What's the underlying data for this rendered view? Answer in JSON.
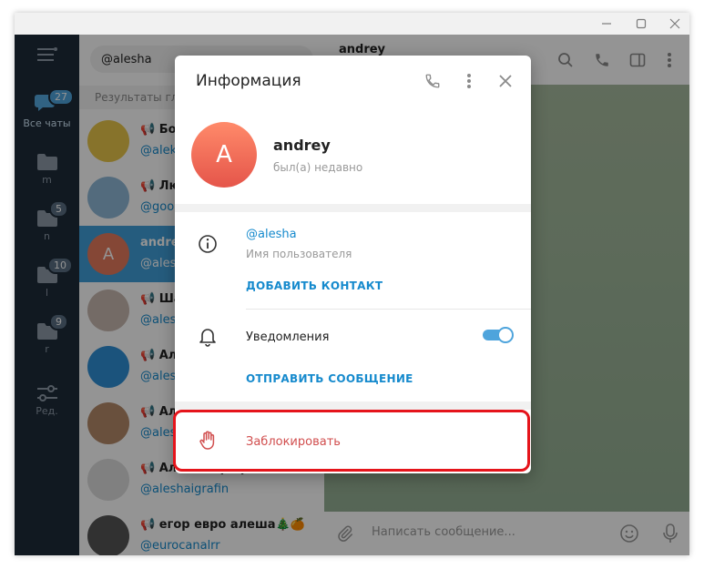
{
  "window": {
    "minimize": "—",
    "maximize": "☐",
    "close": "✕"
  },
  "rail": {
    "items": [
      {
        "id": "all",
        "label": "Все чаты",
        "badge": "27",
        "icon": "chat-bubbles-icon"
      },
      {
        "id": "m",
        "label": "m",
        "badge": "",
        "icon": "folder-icon"
      },
      {
        "id": "n",
        "label": "n",
        "badge": "5",
        "icon": "folder-icon"
      },
      {
        "id": "l",
        "label": "l",
        "badge": "10",
        "icon": "folder-icon"
      },
      {
        "id": "r",
        "label": "r",
        "badge": "9",
        "icon": "folder-icon"
      },
      {
        "id": "edit",
        "label": "Ред.",
        "badge": "",
        "icon": "sliders-icon"
      }
    ]
  },
  "search": {
    "value": "@alesha"
  },
  "results_header": "Результаты гл",
  "chats": [
    {
      "name": "📢 Бо",
      "handle": "@alek",
      "selected": false,
      "avatar_color": "#e8c64a"
    },
    {
      "name": "📢 Лю",
      "handle": "@goo",
      "selected": false,
      "avatar_color": "#8fb8d8"
    },
    {
      "name": "andrey",
      "handle": "@ales",
      "selected": true,
      "avatar_color": "#e67a5e",
      "initial": "A"
    },
    {
      "name": "📢 Ша",
      "handle": "@ales",
      "selected": false,
      "avatar_color": "#c9b8b0"
    },
    {
      "name": "📢 Ал",
      "handle": "@ales",
      "selected": false,
      "avatar_color": "#2f8fd6"
    },
    {
      "name": "📢 Ал",
      "handle": "@ales",
      "selected": false,
      "avatar_color": "#b58a6a"
    },
    {
      "name": "📢 Алешаиграфин",
      "handle": "@aleshaigrafin",
      "selected": false,
      "avatar_color": "#dddddd"
    },
    {
      "name": "📢 егор евро алеша🎄🍊",
      "handle": "@eurocanalrr",
      "selected": false,
      "avatar_color": "#555555"
    }
  ],
  "chat": {
    "title": "andrey",
    "composer_placeholder": "Написать сообщение..."
  },
  "modal": {
    "title": "Информация",
    "profile": {
      "initial": "A",
      "name": "andrey",
      "status": "был(а) недавно"
    },
    "username": "@alesha",
    "username_caption": "Имя пользователя",
    "add_contact": "ДОБАВИТЬ КОНТАКТ",
    "notifications_label": "Уведомления",
    "notifications_on": true,
    "send_message": "ОТПРАВИТЬ СООБЩЕНИЕ",
    "block": "Заблокировать"
  },
  "colors": {
    "accent": "#168acd",
    "selected_row": "#419fd9",
    "danger": "#d14e4e",
    "highlight": "#e5141b",
    "rail": "#1e2c3a"
  }
}
